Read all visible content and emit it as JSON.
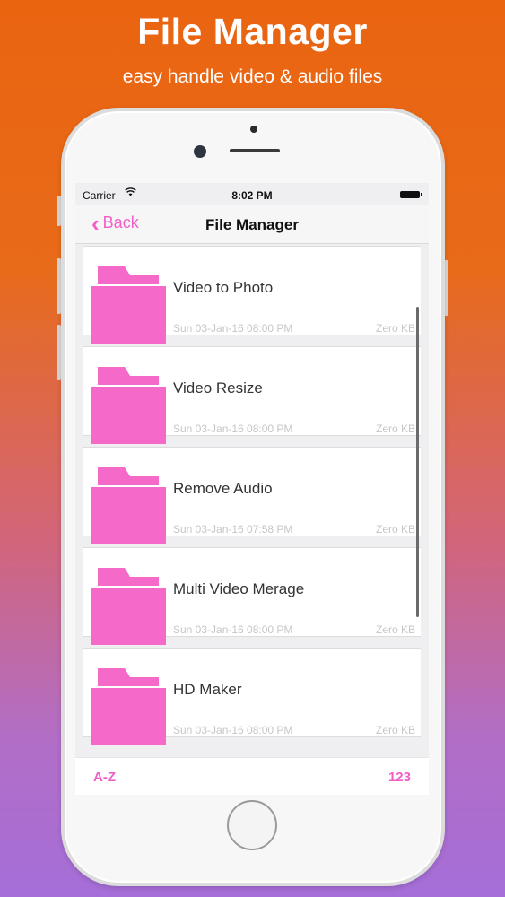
{
  "promo": {
    "title": "File Manager",
    "subtitle": "easy handle video & audio files"
  },
  "status_bar": {
    "carrier": "Carrier",
    "time": "8:02 PM"
  },
  "nav": {
    "back_label": "Back",
    "title": "File Manager"
  },
  "files": [
    {
      "name": "Video to Photo",
      "date": "Sun 03-Jan-16 08:00 PM",
      "size": "Zero KB"
    },
    {
      "name": "Video Resize",
      "date": "Sun 03-Jan-16 08:00 PM",
      "size": "Zero KB"
    },
    {
      "name": "Remove Audio",
      "date": "Sun 03-Jan-16 07:58 PM",
      "size": "Zero KB"
    },
    {
      "name": "Multi Video Merage",
      "date": "Sun 03-Jan-16 08:00 PM",
      "size": "Zero KB"
    },
    {
      "name": "HD Maker",
      "date": "Sun 03-Jan-16 08:00 PM",
      "size": "Zero KB"
    }
  ],
  "bottom_bar": {
    "sort_alpha_label": "A-Z",
    "sort_numeric_label": "123"
  },
  "colors": {
    "accent": "#f25ec8",
    "folder": "#f56ac9",
    "background_top": "#ea6410",
    "background_bottom": "#a56ed8"
  },
  "icons": {
    "back": "chevron-left-icon",
    "wifi": "wifi-icon",
    "battery": "battery-icon",
    "folder": "folder-icon"
  }
}
